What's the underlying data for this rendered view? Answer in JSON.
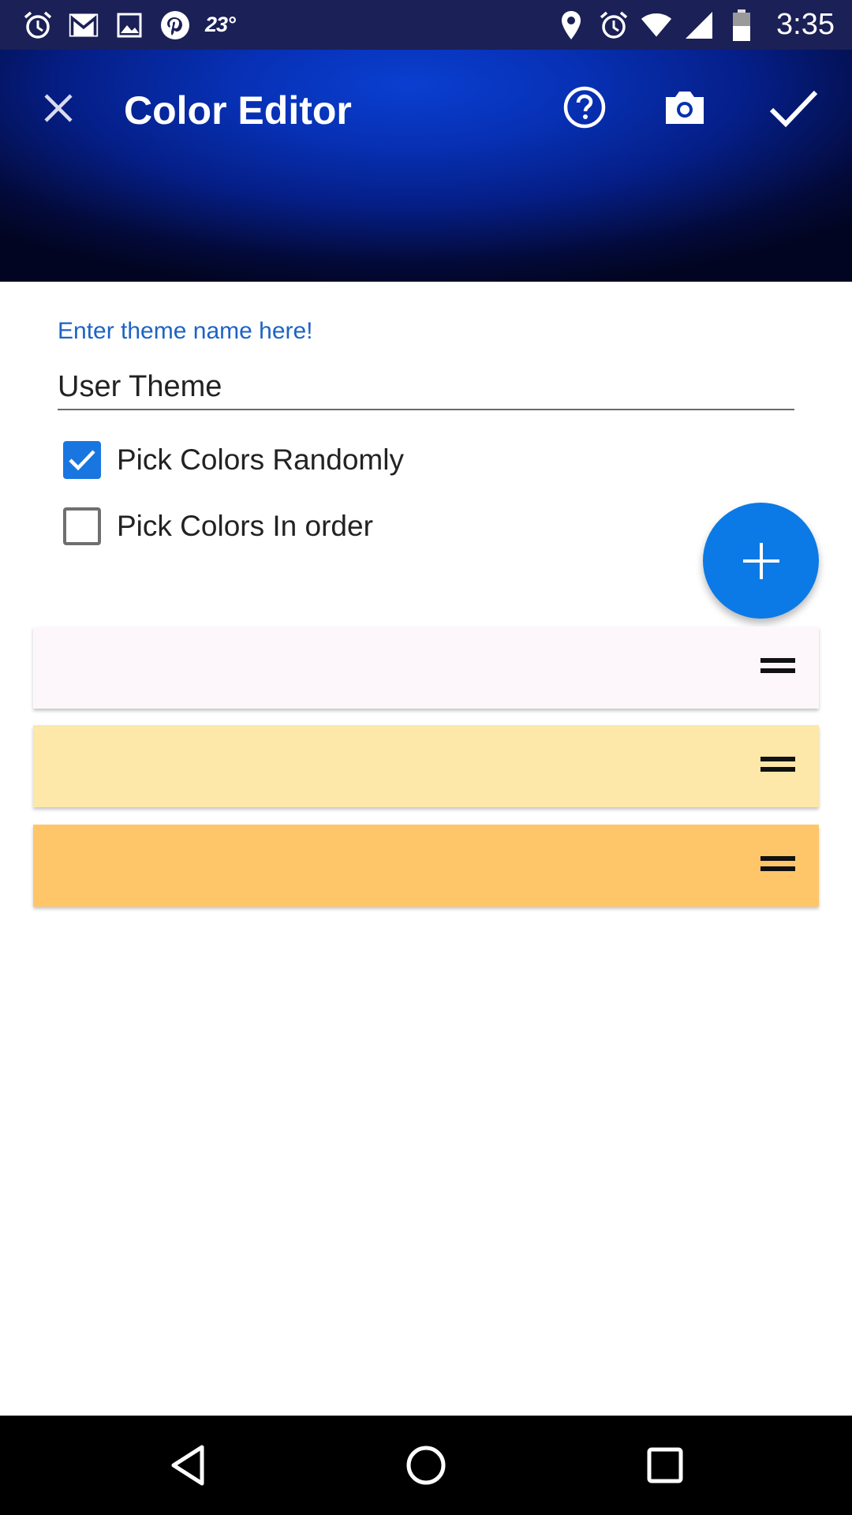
{
  "status_bar": {
    "temperature": "23°",
    "time": "3:35",
    "left_icons": [
      "alarm-icon",
      "gmail-icon",
      "image-icon",
      "pinterest-icon"
    ],
    "right_icons": [
      "location-icon",
      "alarm-icon",
      "wifi-icon",
      "signal-icon",
      "battery-icon"
    ]
  },
  "app_bar": {
    "title": "Color Editor",
    "icons": [
      "close-icon",
      "help-icon",
      "camera-icon",
      "check-icon"
    ],
    "gradient_colors": [
      "#0a3fd0",
      "#051e86",
      "#020521"
    ]
  },
  "form": {
    "name_label": "Enter theme name here!",
    "name_value": "User Theme",
    "options": [
      {
        "label": "Pick Colors Randomly",
        "checked": true
      },
      {
        "label": "Pick Colors In order",
        "checked": false
      }
    ],
    "accent_color": "#1976e0"
  },
  "fab": {
    "icon": "plus-icon",
    "color": "#0b7ae6"
  },
  "colors": [
    {
      "color": "#fdf7fb"
    },
    {
      "color": "#fde7a9"
    },
    {
      "color": "#ffc669"
    }
  ],
  "nav_bar": {
    "icons": [
      "back-icon",
      "home-icon",
      "recents-icon"
    ]
  }
}
